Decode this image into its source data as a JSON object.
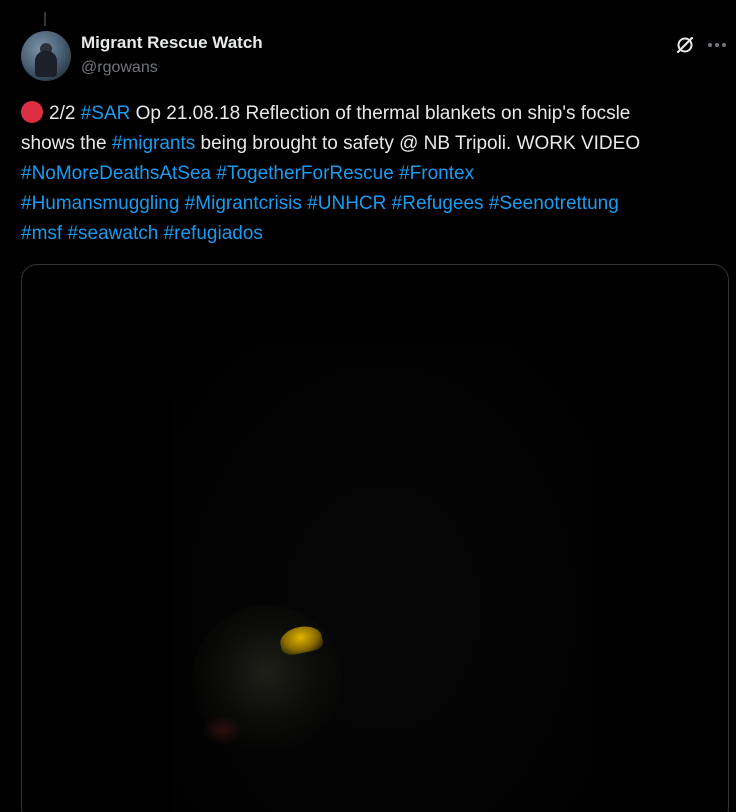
{
  "author": {
    "name": "Migrant Rescue Watch",
    "handle": "@rgowans"
  },
  "icons": {
    "grok": "grok-icon",
    "more": "more-options-icon",
    "status": "red-circle-icon"
  },
  "colors": {
    "background": "#000000",
    "text": "#e7e9ea",
    "secondary": "#71767b",
    "link": "#1d9bf0",
    "status_dot": "#dd2e44"
  },
  "tweet": {
    "line1": {
      "a": "2/2 ",
      "tag": "#SAR",
      "b": " Op 21.08.18 Reflection of thermal blankets on ship's focsle"
    },
    "line2": {
      "a": "shows the ",
      "tag": "#migrants",
      "b": " being brought to safety @ NB Tripoli. WORK VIDEO"
    },
    "hashtags_line3": [
      "#NoMoreDeathsAtSea",
      "#TogetherForRescue",
      "#Frontex"
    ],
    "hashtags_line4": [
      "#Humansmuggling",
      "#Migrantcrisis",
      "#UNHCR",
      "#Refugees",
      "#Seenotrettung"
    ],
    "hashtags_line5": [
      "#msf",
      "#seawatch",
      "#refugiados"
    ]
  },
  "media": {
    "type": "video",
    "description_icon": "video-player"
  }
}
